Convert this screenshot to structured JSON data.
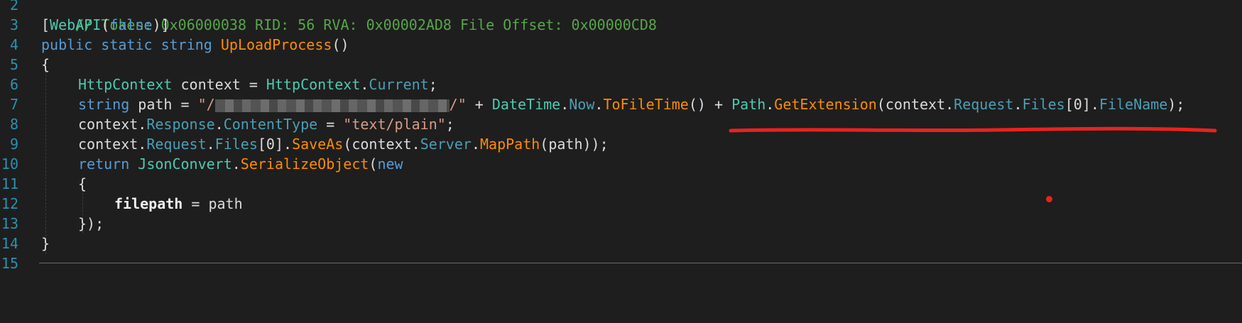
{
  "editor": {
    "line_numbers": [
      "2",
      "3",
      "4",
      "5",
      "6",
      "7",
      "8",
      "9",
      "10",
      "11",
      "12",
      "13",
      "14",
      "15"
    ],
    "line2": {
      "comment": "// Token: 0x06000038 RID: 56 RVA: 0x00002AD8 File Offset: 0x00000CD8"
    },
    "line3": {
      "open": "[",
      "attr": "WebAPI",
      "p1": "(",
      "arg": "false",
      "close": ")]"
    },
    "line4": {
      "kw1": "public",
      "kw2": "static",
      "kw3": "string",
      "name": "UpLoadProcess",
      "parens": "()"
    },
    "line5": {
      "brace": "{"
    },
    "line6": {
      "type": "HttpContext",
      "var": " context = ",
      "type2": "HttpContext",
      "dot": ".",
      "member": "Current",
      "end": ";"
    },
    "line7": {
      "kw": "string",
      "var": " path = ",
      "str_open": "\"/",
      "str_close": "/\"",
      "plus1": " + ",
      "t1": "DateTime",
      "d1": ".",
      "m1": "Now",
      "d2": ".",
      "m2": "ToFileTime",
      "p1": "() + ",
      "t2": "Path",
      "d3": ".",
      "m3": "GetExtension",
      "p2": "(context.",
      "m4": "Request",
      "d4": ".",
      "m5": "Files",
      "idx": "[0].",
      "m6": "FileName",
      "end": ");"
    },
    "line8": {
      "a": "context.",
      "m1": "Response",
      "d": ".",
      "m2": "ContentType",
      "eq": " = ",
      "str": "\"text/plain\"",
      "end": ";"
    },
    "line9": {
      "a": "context.",
      "m1": "Request",
      "d1": ".",
      "m2": "Files",
      "idx": "[0].",
      "m3": "SaveAs",
      "p1": "(context.",
      "m4": "Server",
      "d2": ".",
      "m5": "MapPath",
      "end": "(path));"
    },
    "line10": {
      "kw": "return",
      "t": "JsonConvert",
      "d": ".",
      "m": "SerializeObject",
      "p": "(",
      "kw2": "new"
    },
    "line11": {
      "brace": "{"
    },
    "line12": {
      "prop": "filepath",
      "rest": " = path"
    },
    "line13": {
      "close": "});"
    },
    "line14": {
      "brace": "}"
    }
  },
  "colors": {
    "background": "#1e1e1e",
    "line_number": "#2b91af",
    "keyword": "#569cd6",
    "type": "#4ec9b0",
    "method": "#ff8c00",
    "comment": "#57a64a",
    "annotation_red": "#e8231f"
  }
}
